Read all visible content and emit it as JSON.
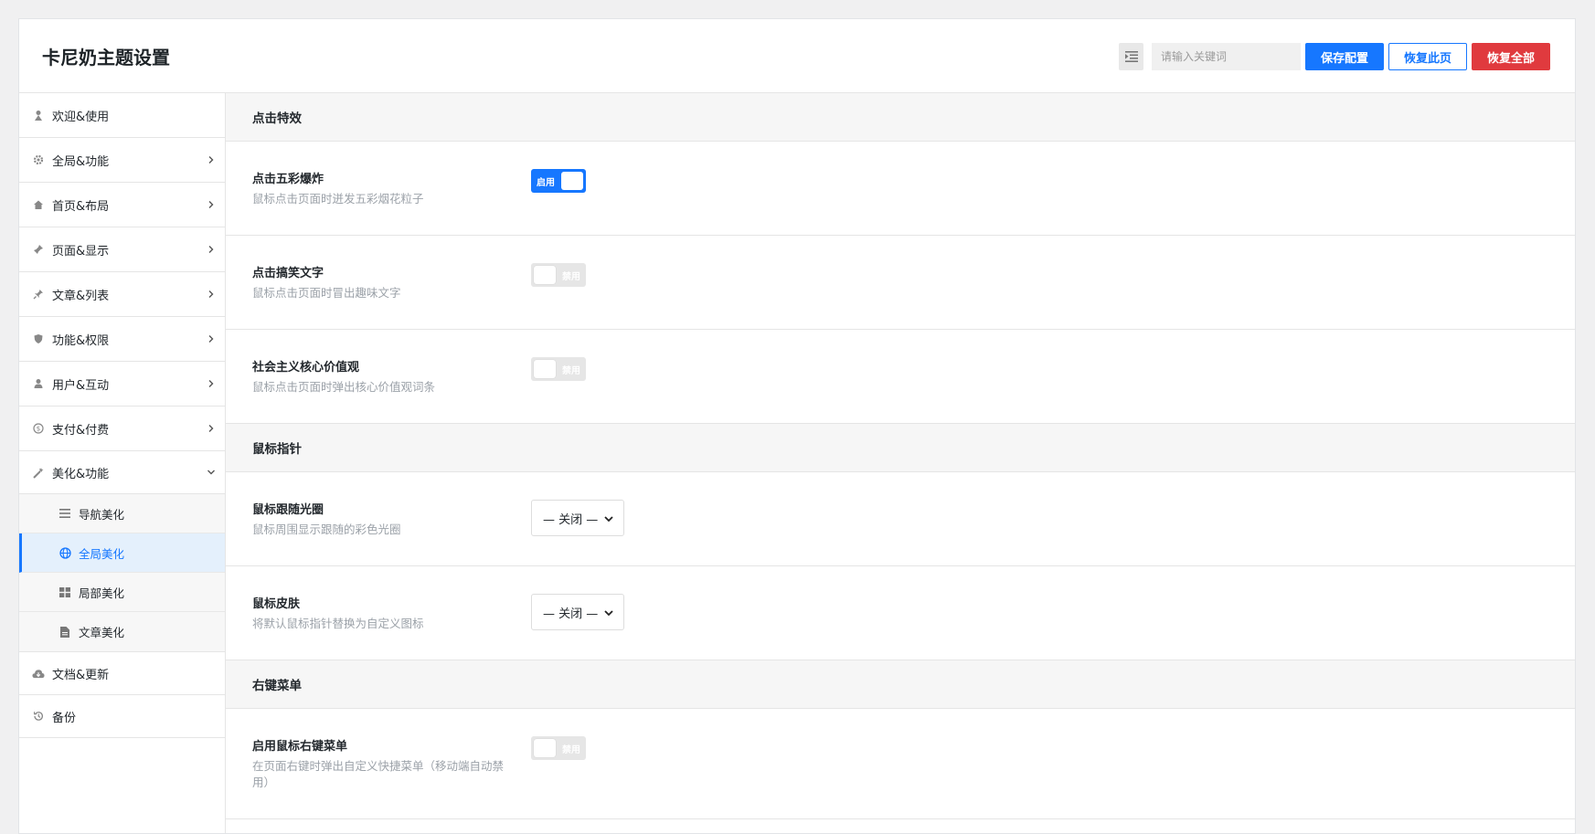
{
  "header": {
    "title": "卡尼奶主题设置",
    "search_placeholder": "请输入关键词",
    "save_label": "保存配置",
    "reset_page_label": "恢复此页",
    "reset_all_label": "恢复全部"
  },
  "sidebar": {
    "items": [
      {
        "label": "欢迎&使用",
        "icon": "welcome-icon"
      },
      {
        "label": "全局&功能",
        "icon": "gear-icon"
      },
      {
        "label": "首页&布局",
        "icon": "home-icon"
      },
      {
        "label": "页面&显示",
        "icon": "pin-icon"
      },
      {
        "label": "文章&列表",
        "icon": "pushpin-icon"
      },
      {
        "label": "功能&权限",
        "icon": "shield-icon"
      },
      {
        "label": "用户&互动",
        "icon": "user-icon"
      },
      {
        "label": "支付&付费",
        "icon": "coin-icon"
      },
      {
        "label": "美化&功能",
        "icon": "magic-wand-icon"
      }
    ],
    "sub_items": [
      {
        "label": "导航美化",
        "icon": "list-icon"
      },
      {
        "label": "全局美化",
        "icon": "globe-icon"
      },
      {
        "label": "局部美化",
        "icon": "grid-icon"
      },
      {
        "label": "文章美化",
        "icon": "document-icon"
      }
    ],
    "bottom_items": [
      {
        "label": "文档&更新",
        "icon": "cloud-icon"
      },
      {
        "label": "备份",
        "icon": "history-icon"
      }
    ]
  },
  "sections": {
    "click": {
      "title": "点击特效",
      "rows": [
        {
          "label": "点击五彩爆炸",
          "desc": "鼠标点击页面时迸发五彩烟花粒子",
          "toggle": "启用"
        },
        {
          "label": "点击搞笑文字",
          "desc": "鼠标点击页面时冒出趣味文字",
          "toggle": "禁用"
        },
        {
          "label": "社会主义核心价值观",
          "desc": "鼠标点击页面时弹出核心价值观词条",
          "toggle": "禁用"
        }
      ]
    },
    "cursor": {
      "title": "鼠标指针",
      "rows": [
        {
          "label": "鼠标跟随光圈",
          "desc": "鼠标周围显示跟随的彩色光圈",
          "select": "— 关闭 —"
        },
        {
          "label": "鼠标皮肤",
          "desc": "将默认鼠标指针替换为自定义图标",
          "select": "— 关闭 —"
        }
      ]
    },
    "context": {
      "title": "右键菜单",
      "rows": [
        {
          "label": "启用鼠标右键菜单",
          "desc": "在页面右键时弹出自定义快捷菜单（移动端自动禁用）",
          "toggle": "禁用"
        }
      ]
    }
  },
  "colors": {
    "accent": "#1677ff",
    "danger": "#e03a3e",
    "active_bg": "#e4f0fc"
  }
}
